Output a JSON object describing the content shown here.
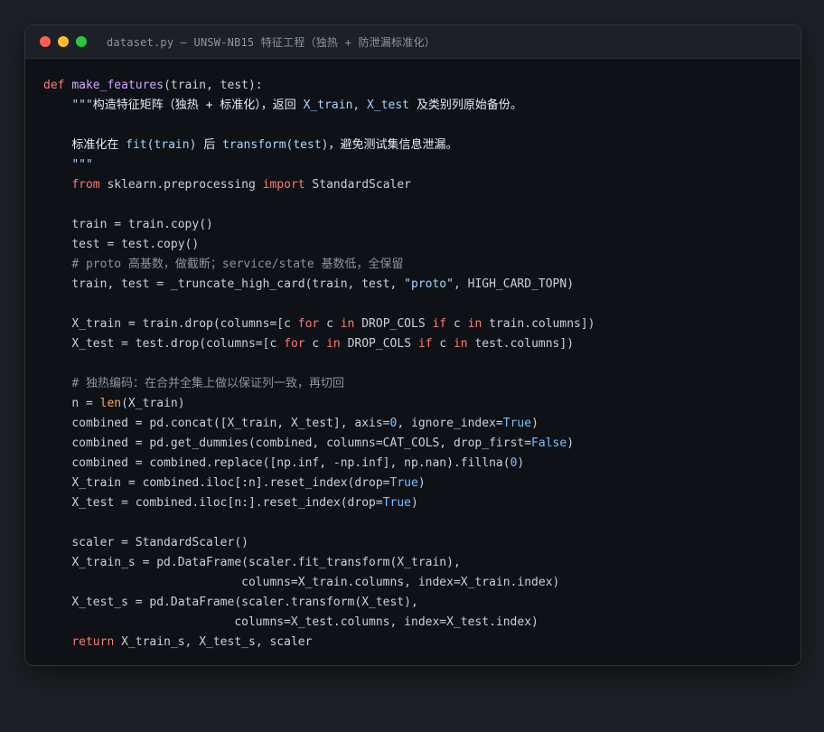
{
  "window": {
    "title": "dataset.py — UNSW-NB15 特征工程（独热 + 防泄漏标准化）",
    "traffic_lights": [
      {
        "name": "close",
        "color": "#ff5f57"
      },
      {
        "name": "minimize",
        "color": "#febc2e"
      },
      {
        "name": "zoom",
        "color": "#28c840"
      }
    ]
  },
  "colors": {
    "keyword": "#ff7b72",
    "function_name": "#d2a8ff",
    "builtin": "#ffa657",
    "string": "#a5d6ff",
    "number_constant": "#79c0ff",
    "comment": "#8b949e",
    "default_text": "#c9d1d9",
    "background": "#0e1116"
  },
  "code": {
    "lines": [
      {
        "indent": 0,
        "tokens": [
          [
            "kw",
            "def"
          ],
          [
            "t",
            " "
          ],
          [
            "fn",
            "make_features"
          ],
          [
            "t",
            "(train, test):"
          ]
        ]
      },
      {
        "indent": 1,
        "tokens": [
          [
            "doc",
            "\"\"\""
          ],
          [
            "doc-cn",
            "构造特征矩阵（独热 + 标准化），返回 "
          ],
          [
            "doc",
            "X_train, X_test"
          ],
          [
            "doc-cn",
            " 及类别列原始备份。"
          ]
        ]
      },
      {
        "indent": 0,
        "tokens": []
      },
      {
        "indent": 1,
        "tokens": [
          [
            "doc-cn",
            "标准化在 "
          ],
          [
            "doc",
            "fit(train)"
          ],
          [
            "doc-cn",
            " 后 "
          ],
          [
            "doc",
            "transform(test)"
          ],
          [
            "doc-cn",
            "，避免测试集信息泄漏。"
          ]
        ]
      },
      {
        "indent": 1,
        "tokens": [
          [
            "doc",
            "\"\"\""
          ]
        ]
      },
      {
        "indent": 1,
        "tokens": [
          [
            "kw",
            "from"
          ],
          [
            "t",
            " sklearn.preprocessing "
          ],
          [
            "kw",
            "import"
          ],
          [
            "t",
            " StandardScaler"
          ]
        ]
      },
      {
        "indent": 0,
        "tokens": []
      },
      {
        "indent": 1,
        "tokens": [
          [
            "t",
            "train = train.copy()"
          ]
        ]
      },
      {
        "indent": 1,
        "tokens": [
          [
            "t",
            "test = test.copy()"
          ]
        ]
      },
      {
        "indent": 1,
        "tokens": [
          [
            "cm",
            "# proto 高基数，做截断；service/state 基数低，全保留"
          ]
        ]
      },
      {
        "indent": 1,
        "tokens": [
          [
            "t",
            "train, test = _truncate_high_card(train, test, "
          ],
          [
            "str",
            "\"proto\""
          ],
          [
            "t",
            ", HIGH_CARD_TOPN)"
          ]
        ]
      },
      {
        "indent": 0,
        "tokens": []
      },
      {
        "indent": 1,
        "tokens": [
          [
            "t",
            "X_train = train.drop(columns=[c "
          ],
          [
            "kw",
            "for"
          ],
          [
            "t",
            " c "
          ],
          [
            "kw",
            "in"
          ],
          [
            "t",
            " DROP_COLS "
          ],
          [
            "kw",
            "if"
          ],
          [
            "t",
            " c "
          ],
          [
            "kw",
            "in"
          ],
          [
            "t",
            " train.columns])"
          ]
        ]
      },
      {
        "indent": 1,
        "tokens": [
          [
            "t",
            "X_test = test.drop(columns=[c "
          ],
          [
            "kw",
            "for"
          ],
          [
            "t",
            " c "
          ],
          [
            "kw",
            "in"
          ],
          [
            "t",
            " DROP_COLS "
          ],
          [
            "kw",
            "if"
          ],
          [
            "t",
            " c "
          ],
          [
            "kw",
            "in"
          ],
          [
            "t",
            " test.columns])"
          ]
        ]
      },
      {
        "indent": 0,
        "tokens": []
      },
      {
        "indent": 1,
        "tokens": [
          [
            "cm",
            "# 独热编码：在合并全集上做以保证列一致，再切回"
          ]
        ]
      },
      {
        "indent": 1,
        "tokens": [
          [
            "t",
            "n = "
          ],
          [
            "bi",
            "len"
          ],
          [
            "t",
            "(X_train)"
          ]
        ]
      },
      {
        "indent": 1,
        "tokens": [
          [
            "t",
            "combined = pd.concat([X_train, X_test], axis="
          ],
          [
            "num",
            "0"
          ],
          [
            "t",
            ", ignore_index="
          ],
          [
            "num",
            "True"
          ],
          [
            "t",
            ")"
          ]
        ]
      },
      {
        "indent": 1,
        "tokens": [
          [
            "t",
            "combined = pd.get_dummies(combined, columns=CAT_COLS, drop_first="
          ],
          [
            "num",
            "False"
          ],
          [
            "t",
            ")"
          ]
        ]
      },
      {
        "indent": 1,
        "tokens": [
          [
            "t",
            "combined = combined.replace([np.inf, -np.inf], np.nan).fillna("
          ],
          [
            "num",
            "0"
          ],
          [
            "t",
            ")"
          ]
        ]
      },
      {
        "indent": 1,
        "tokens": [
          [
            "t",
            "X_train = combined.iloc[:n].reset_index(drop="
          ],
          [
            "num",
            "True"
          ],
          [
            "t",
            ")"
          ]
        ]
      },
      {
        "indent": 1,
        "tokens": [
          [
            "t",
            "X_test = combined.iloc[n:].reset_index(drop="
          ],
          [
            "num",
            "True"
          ],
          [
            "t",
            ")"
          ]
        ]
      },
      {
        "indent": 0,
        "tokens": []
      },
      {
        "indent": 1,
        "tokens": [
          [
            "t",
            "scaler = StandardScaler()"
          ]
        ]
      },
      {
        "indent": 1,
        "tokens": [
          [
            "t",
            "X_train_s = pd.DataFrame(scaler.fit_transform(X_train),"
          ]
        ]
      },
      {
        "indent": 0,
        "tokens": [
          [
            "t",
            "                            columns=X_train.columns, index=X_train.index)"
          ]
        ]
      },
      {
        "indent": 1,
        "tokens": [
          [
            "t",
            "X_test_s = pd.DataFrame(scaler.transform(X_test),"
          ]
        ]
      },
      {
        "indent": 0,
        "tokens": [
          [
            "t",
            "                           columns=X_test.columns, index=X_test.index)"
          ]
        ]
      },
      {
        "indent": 1,
        "tokens": [
          [
            "kw",
            "return"
          ],
          [
            "t",
            " X_train_s, X_test_s, scaler"
          ]
        ]
      }
    ]
  }
}
